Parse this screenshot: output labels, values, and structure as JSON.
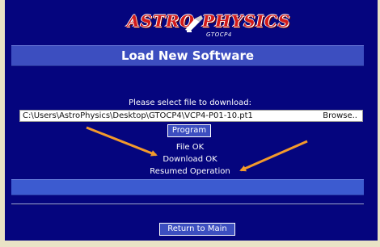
{
  "logo": {
    "left_word": "ASTRO",
    "right_word": "PHYSICS",
    "subtext": "GTOCP4"
  },
  "page": {
    "title": "Load New Software"
  },
  "upload": {
    "prompt": "Please select file to download:",
    "file_path": "C:\\Users\\AstroPhysics\\Desktop\\GTOCP4\\VCP4-P01-10.pt1",
    "browse_label": "Browse..",
    "program_label": "Program"
  },
  "status": {
    "file": "File OK",
    "download": "Download OK",
    "resumed": "Resumed Operation"
  },
  "footer": {
    "return_label": "Return to Main"
  },
  "colors": {
    "background": "#05057e",
    "bar": "#3c4ec0",
    "arrow": "#f39a2b",
    "logo_red": "#d11a1a"
  },
  "icons": {
    "logo_mark": "telescope-icon"
  }
}
